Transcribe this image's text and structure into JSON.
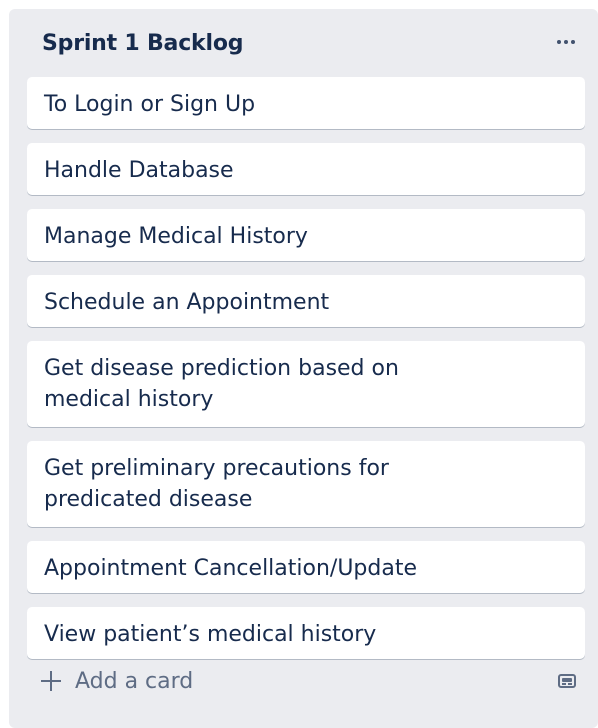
{
  "list": {
    "title": "Sprint 1 Backlog",
    "menu_icon": "more-icon"
  },
  "cards": [
    {
      "text": "To Login or Sign Up",
      "lines": 1
    },
    {
      "text": "Handle Database",
      "lines": 1
    },
    {
      "text": "Manage Medical History",
      "lines": 1
    },
    {
      "text": "Schedule an Appointment",
      "lines": 1
    },
    {
      "text": "Get disease prediction based on\nmedical history",
      "lines": 2
    },
    {
      "text": "Get preliminary precautions for\npredicated disease",
      "lines": 2
    },
    {
      "text": "Appointment Cancellation/Update",
      "lines": 1
    },
    {
      "text": "View patient’s medical history",
      "lines": 1
    }
  ],
  "composer": {
    "add_card_label": "Add a card",
    "add_icon": "plus-icon",
    "template_icon": "card-template-icon"
  },
  "colors": {
    "list_background": "#ebecf0",
    "card_background": "#ffffff",
    "text": "#172b4d",
    "muted_text": "#5e6c84"
  }
}
